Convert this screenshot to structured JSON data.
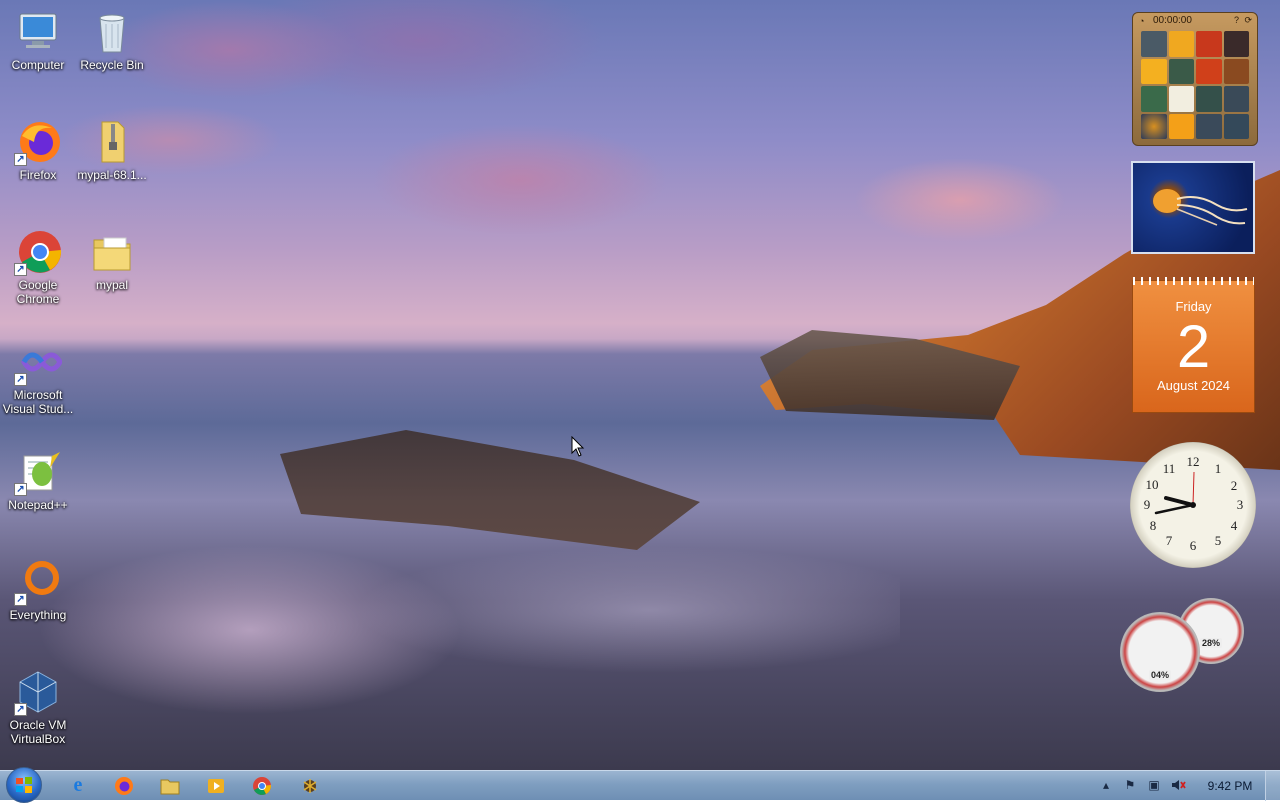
{
  "desktop": {
    "icons": [
      {
        "label": "Computer",
        "icon": "computer-icon",
        "shortcut": false
      },
      {
        "label": "Recycle Bin",
        "icon": "recycle-bin-icon",
        "shortcut": false
      },
      {
        "label": "Firefox",
        "icon": "firefox-icon",
        "shortcut": true
      },
      {
        "label": "mypal-68.1...",
        "icon": "zip-folder-icon",
        "shortcut": false
      },
      {
        "label": "Google Chrome",
        "icon": "chrome-icon",
        "shortcut": true
      },
      {
        "label": "mypal",
        "icon": "folder-icon",
        "shortcut": false
      },
      {
        "label": "Microsoft Visual Stud...",
        "icon": "visual-studio-icon",
        "shortcut": true
      },
      {
        "label": "Notepad++",
        "icon": "notepad-plus-plus-icon",
        "shortcut": true
      },
      {
        "label": "Everything",
        "icon": "everything-search-icon",
        "shortcut": true
      },
      {
        "label": "Oracle VM VirtualBox",
        "icon": "virtualbox-icon",
        "shortcut": true
      }
    ]
  },
  "gadgets": {
    "puzzle": {
      "timer": "00:00:00"
    },
    "calendar": {
      "weekday": "Friday",
      "day": "2",
      "month_year": "August 2024"
    },
    "clock": {
      "numbers": [
        "12",
        "1",
        "2",
        "3",
        "4",
        "5",
        "6",
        "7",
        "8",
        "9",
        "10",
        "11"
      ]
    },
    "cpu_meter": {
      "cpu": "04%",
      "memory": "28%"
    }
  },
  "taskbar": {
    "pinned": [
      {
        "name": "internet-explorer-icon"
      },
      {
        "name": "firefox-icon"
      },
      {
        "name": "file-explorer-icon"
      },
      {
        "name": "media-player-icon"
      },
      {
        "name": "chrome-icon"
      },
      {
        "name": "app-icon"
      }
    ],
    "tray": {
      "time": "9:42 PM",
      "icons": [
        "show-hidden-icons-chevron",
        "action-center-flag-icon",
        "network-icon",
        "volume-muted-icon"
      ]
    }
  },
  "colors": {
    "calendar_orange": "#e6762a",
    "taskbar_blue": "#7f9ec0"
  }
}
